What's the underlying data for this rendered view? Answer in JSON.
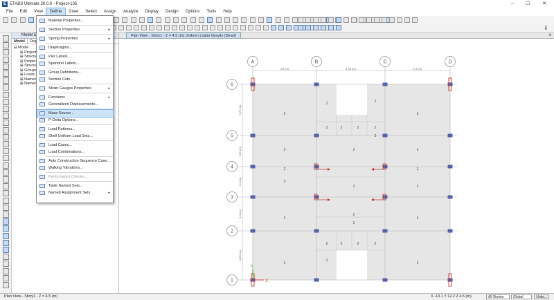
{
  "window": {
    "title": "ETABS Ultimate 20.0.0 - Project-105",
    "app_icon": "E",
    "minimize": "–",
    "maximize": "☐",
    "close": "✕"
  },
  "menubar": [
    "File",
    "Edit",
    "View",
    "Define",
    "Draw",
    "Select",
    "Assign",
    "Analyze",
    "Display",
    "Design",
    "Options",
    "Tools",
    "Help"
  ],
  "menubar_active": "Define",
  "explorer": {
    "header": "Model Exp",
    "tabs": [
      "Model",
      "Display"
    ],
    "tree": [
      {
        "label": "⊟ Model",
        "level": 0
      },
      {
        "label": "⊞ Project",
        "level": 1
      },
      {
        "label": "⊞ Structure",
        "level": 1
      },
      {
        "label": "⊞ Properties",
        "level": 1
      },
      {
        "label": "⊞ Structural",
        "level": 1
      },
      {
        "label": "⊞ Groups",
        "level": 1
      },
      {
        "label": "⊞ Loads",
        "level": 1
      },
      {
        "label": "⊞ Named O...",
        "level": 1
      },
      {
        "label": "⊞ Named P...",
        "level": 1
      }
    ]
  },
  "define_menu": [
    {
      "label": "Material Properties...",
      "submenu": false
    },
    {
      "sep": true
    },
    {
      "label": "Section Properties",
      "submenu": true
    },
    {
      "sep": true
    },
    {
      "label": "Spring Properties",
      "submenu": true
    },
    {
      "sep": true
    },
    {
      "label": "Diaphragms...",
      "submenu": false
    },
    {
      "sep": true
    },
    {
      "label": "Pier Labels...",
      "submenu": false
    },
    {
      "label": "Spandrel Labels...",
      "submenu": false
    },
    {
      "sep": true
    },
    {
      "label": "Group Definitions...",
      "submenu": false
    },
    {
      "label": "Section Cuts...",
      "submenu": false
    },
    {
      "sep": true
    },
    {
      "label": "Strain Gauges Properties",
      "submenu": true
    },
    {
      "sep": true
    },
    {
      "label": "Functions",
      "submenu": true
    },
    {
      "label": "Generalized Displacements...",
      "submenu": false
    },
    {
      "sep": true
    },
    {
      "label": "Mass Source...",
      "submenu": false,
      "highlight": true
    },
    {
      "label": "P-Delta Options...",
      "submenu": false
    },
    {
      "sep": true
    },
    {
      "label": "Load Patterns...",
      "submenu": false
    },
    {
      "label": "Shell Uniform Load Sets...",
      "submenu": false
    },
    {
      "sep": true
    },
    {
      "label": "Load Cases...",
      "submenu": false
    },
    {
      "label": "Load Combinations...",
      "submenu": false
    },
    {
      "sep": true
    },
    {
      "label": "Auto Construction Sequence Case...",
      "submenu": false
    },
    {
      "label": "Walking Vibrations...",
      "submenu": false
    },
    {
      "sep": true
    },
    {
      "label": "Performance Checks...",
      "submenu": false,
      "disabled": true
    },
    {
      "sep": true
    },
    {
      "label": "Table Named Sets...",
      "submenu": false
    },
    {
      "label": "Named Assignment Sets",
      "submenu": true
    }
  ],
  "plan_view": {
    "tab_label": "Plan View - Story1 - Z = 4.5 (m)  Uniform Loads Gravity  (Dead)",
    "close": "x",
    "grid_x": [
      "A",
      "B",
      "C",
      "D"
    ],
    "grid_y": [
      "6",
      "5",
      "4",
      "3",
      "2",
      "1"
    ],
    "dims_x": [
      "5.4 (m)",
      "3.93 (m)",
      "5.4 (m)"
    ],
    "dims_y": [
      "3.75 (m)",
      "3.5 (m)",
      "3.1 (m)",
      "3.4 (m)",
      "4.95 (m)"
    ],
    "load_values": [
      "2",
      "2",
      "2",
      "2",
      "2",
      "2",
      "2",
      "2",
      "2",
      "2",
      "2",
      "2",
      "3",
      "2",
      "2",
      "2",
      "2",
      "2",
      "2",
      "2",
      "2",
      "2",
      "2",
      "2",
      "2",
      "2",
      "2",
      "2"
    ],
    "axis_x": "X",
    "axis_y": "Y"
  },
  "status": {
    "left": "Plan View - Story1 - Z = 4.5 (m)",
    "coords": "X -13.1  Y 12.2  Z 4.5 (m)",
    "story_select": "All Stories",
    "coord_select": "Global",
    "units_button": "Units..."
  },
  "colors": {
    "accent": "#cde4f7",
    "shell": "#e6e6e6",
    "column": "#5561a8",
    "wall": "#c0392b",
    "grid": "#b0b0b0"
  }
}
